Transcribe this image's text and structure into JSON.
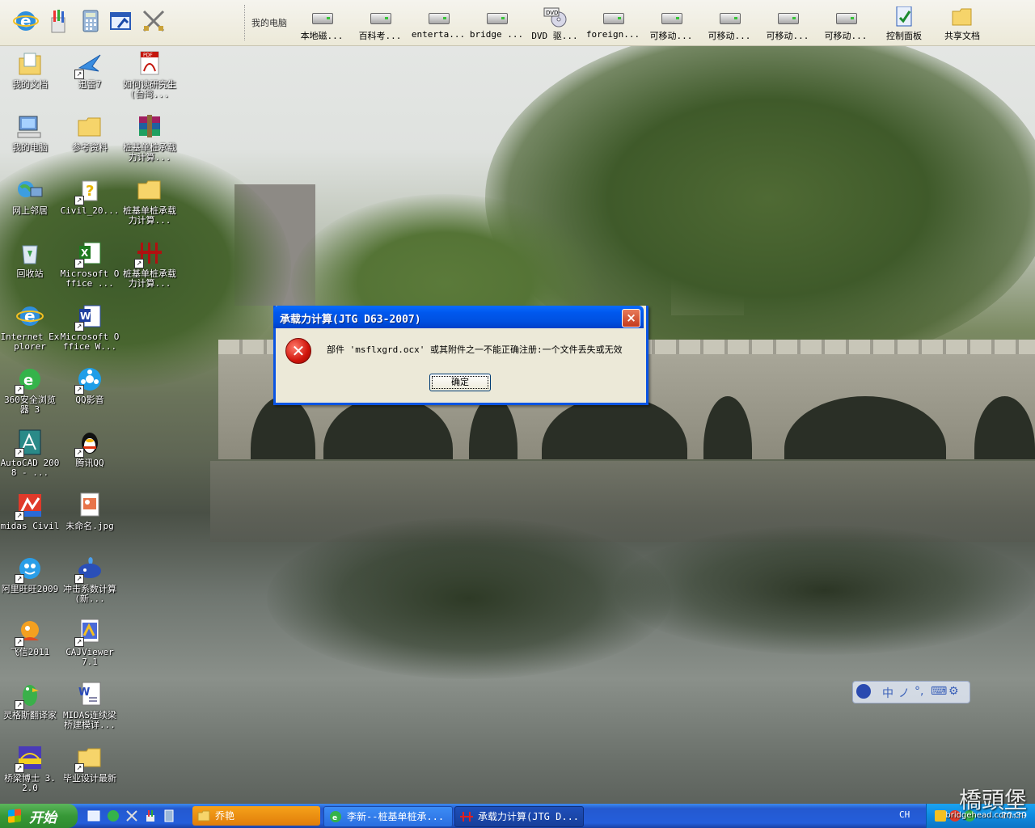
{
  "toolbar": {
    "title": "我的电脑",
    "items": [
      {
        "label": "本地磁...",
        "icon": "hard-drive-icon"
      },
      {
        "label": "百科考...",
        "icon": "hard-drive-icon"
      },
      {
        "label": "enterta...",
        "icon": "hard-drive-icon"
      },
      {
        "label": "bridge ...",
        "icon": "hard-drive-icon"
      },
      {
        "label": "DVD 驱...",
        "icon": "dvd-drive-icon"
      },
      {
        "label": "foreign...",
        "icon": "hard-drive-icon"
      },
      {
        "label": "可移动...",
        "icon": "removable-drive-icon"
      },
      {
        "label": "可移动...",
        "icon": "removable-drive-icon"
      },
      {
        "label": "可移动...",
        "icon": "removable-drive-icon"
      },
      {
        "label": "可移动...",
        "icon": "removable-drive-icon"
      },
      {
        "label": "控制面板",
        "icon": "control-panel-icon"
      },
      {
        "label": "共享文档",
        "icon": "folder-icon"
      }
    ]
  },
  "desktop_icons": [
    {
      "label": "我的文档",
      "icon": "my-documents-icon"
    },
    {
      "label": "迅雷7",
      "icon": "thunder-icon"
    },
    {
      "label": "如何读研究生(台湾...",
      "icon": "pdf-icon"
    },
    {
      "label": "我的电脑",
      "icon": "my-computer-icon"
    },
    {
      "label": "参考资料",
      "icon": "folder-icon"
    },
    {
      "label": "桩基单桩承载力计算...",
      "icon": "winrar-icon"
    },
    {
      "label": "网上邻居",
      "icon": "network-icon"
    },
    {
      "label": "Civil_20...",
      "icon": "help-file-icon"
    },
    {
      "label": "桩基单桩承载力计算...",
      "icon": "folder-icon"
    },
    {
      "label": "回收站",
      "icon": "recycle-bin-icon"
    },
    {
      "label": "Microsoft Office ...",
      "icon": "excel-icon"
    },
    {
      "label": "桩基单桩承载力计算...",
      "icon": "pile-app-icon"
    },
    {
      "label": "Internet Explorer",
      "icon": "ie-icon"
    },
    {
      "label": "Microsoft Office W...",
      "icon": "word-icon"
    },
    {
      "label": "360安全浏览器 3",
      "icon": "browser-360-icon"
    },
    {
      "label": "QQ影音",
      "icon": "qq-player-icon"
    },
    {
      "label": "AutoCAD 2008 - ...",
      "icon": "autocad-icon"
    },
    {
      "label": "腾讯QQ",
      "icon": "qq-penguin-icon"
    },
    {
      "label": "midas Civil",
      "icon": "midas-icon"
    },
    {
      "label": "未命名.jpg",
      "icon": "image-file-icon"
    },
    {
      "label": "阿里旺旺2009",
      "icon": "aliwangwang-icon"
    },
    {
      "label": "冲击系数计算(新...",
      "icon": "whale-icon"
    },
    {
      "label": "飞信2011",
      "icon": "fetion-icon"
    },
    {
      "label": "CAJViewer 7.1",
      "icon": "cajviewer-icon"
    },
    {
      "label": "灵格斯翻译家",
      "icon": "lingoes-parrot-icon"
    },
    {
      "label": "MIDAS连续梁桥建模详...",
      "icon": "word-doc-icon"
    },
    {
      "label": "桥梁博士 3.2.0",
      "icon": "bridge-doctor-icon"
    },
    {
      "label": "毕业设计最新",
      "icon": "folder-icon"
    }
  ],
  "dialog": {
    "title": "承载力计算(JTG D63-2007)",
    "close": "×",
    "message": "部件 'msflxgrd.ocx' 或其附件之一不能正确注册:一个文件丢失或无效",
    "ok_label": "确定"
  },
  "ime": {
    "chars": [
      "中",
      "ノ",
      "°,",
      "⌨",
      "⚙"
    ]
  },
  "taskbar": {
    "start_label": "开始",
    "tasks": [
      {
        "label": "乔艳",
        "icon": "folder-icon"
      },
      {
        "label": "李新--桩基单桩承...",
        "icon": "browser-360-icon"
      },
      {
        "label": "承载力计算(JTG D...",
        "icon": "pile-app-icon"
      }
    ],
    "lang": "CH",
    "clock": "20:39"
  },
  "watermark": {
    "text": "橋頭堡",
    "url": "bridgehead.com.cn"
  },
  "colors": {
    "taskbar": "#245edb",
    "start": "#379837",
    "title_bar": "#0058ee"
  }
}
